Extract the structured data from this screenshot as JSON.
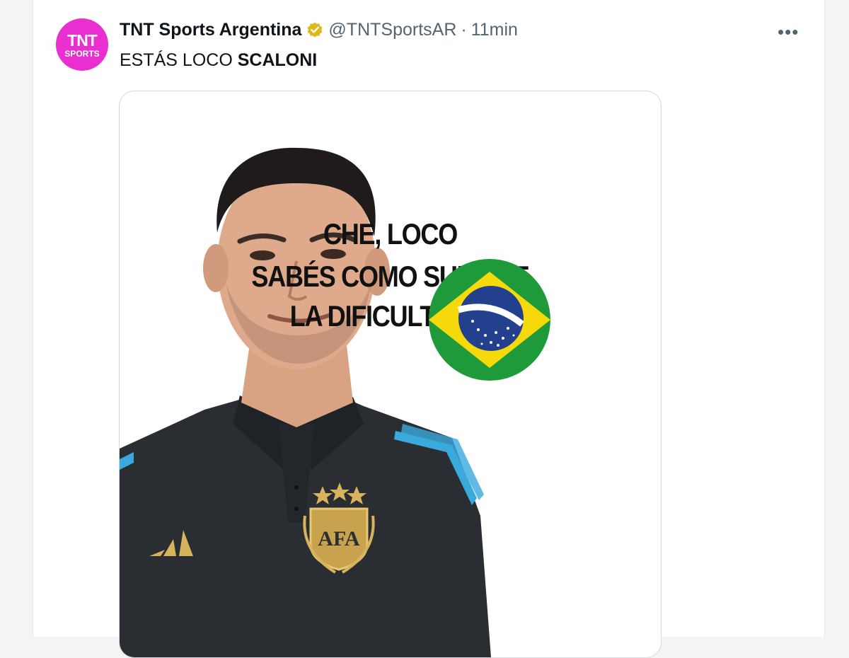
{
  "tweet": {
    "avatar": {
      "line1": "TNT",
      "line2": "SPORTS",
      "color": "#ea2fd0"
    },
    "display_name": "TNT Sports Argentina",
    "verified_icon": "verified-gold-badge-icon",
    "handle": "@TNTSportsAR",
    "separator": "·",
    "timestamp": "11min",
    "more_label": "•••",
    "text_regular": "ESTÁS LOCO ",
    "text_bold": "SCALONI"
  },
  "media": {
    "caption_lines": [
      "CHE, LOCO",
      "SABÉS COMO SUBIRLE",
      "LA DIFICULTAD A"
    ],
    "flag_icon": "brazil-flag-icon",
    "shirt_badge_text": "AFA",
    "colors": {
      "flag_green": "#1f9a3b",
      "flag_yellow": "#f5d90a",
      "flag_blue": "#23408e",
      "shirt": "#2a2e33",
      "stripe": "#3aa9dc"
    }
  }
}
